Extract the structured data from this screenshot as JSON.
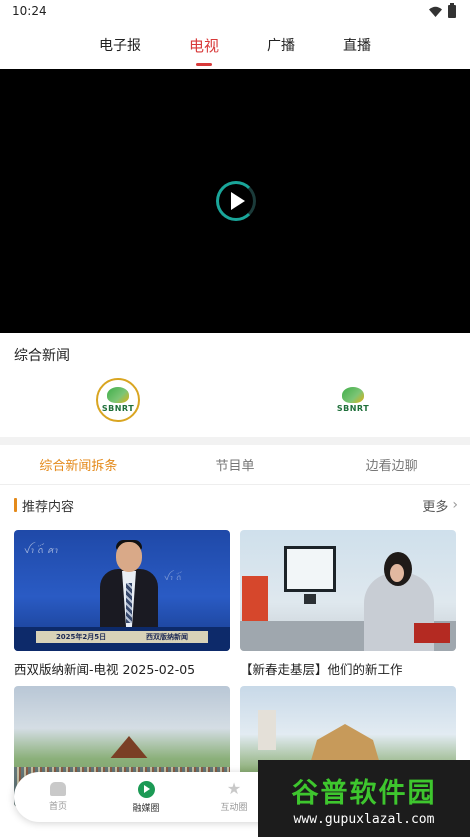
{
  "status_bar": {
    "time": "10:24",
    "icons": [
      "wifi-icon",
      "battery-icon"
    ]
  },
  "top_tabs": [
    {
      "label": "电子报",
      "active": false
    },
    {
      "label": "电视",
      "active": true
    },
    {
      "label": "广播",
      "active": false
    },
    {
      "label": "直播",
      "active": false
    }
  ],
  "player": {
    "state": "loading",
    "icon": "play-icon"
  },
  "channels": {
    "title": "综合新闻",
    "logos": [
      {
        "text": "SBNRT"
      },
      {
        "text": "SBNRT"
      }
    ]
  },
  "sub_tabs": [
    {
      "label": "综合新闻拆条",
      "active": true
    },
    {
      "label": "节目单",
      "active": false
    },
    {
      "label": "边看边聊",
      "active": false
    }
  ],
  "recommend": {
    "title": "推荐内容",
    "more": "更多",
    "cards": [
      {
        "caption": "西双版纳新闻-电视 2025-02-05",
        "banner_date": "2025年2月5日",
        "banner_show": "西双版纳新闻"
      },
      {
        "caption": "【新春走基层】他们的新工作"
      },
      {
        "caption": ""
      },
      {
        "caption": ""
      }
    ]
  },
  "bottom_nav": [
    {
      "label": "首页",
      "icon": "home-icon",
      "active": false
    },
    {
      "label": "融媒圈",
      "icon": "play-circle-icon",
      "active": true
    },
    {
      "label": "互动圈",
      "icon": "star-icon",
      "active": false
    }
  ],
  "watermark": {
    "title": "谷普软件园",
    "url": "www.gupuxlazal.com"
  },
  "colors": {
    "accent_red": "#d83a3a",
    "accent_orange": "#e48a1b",
    "nav_green": "#1c9a55"
  }
}
